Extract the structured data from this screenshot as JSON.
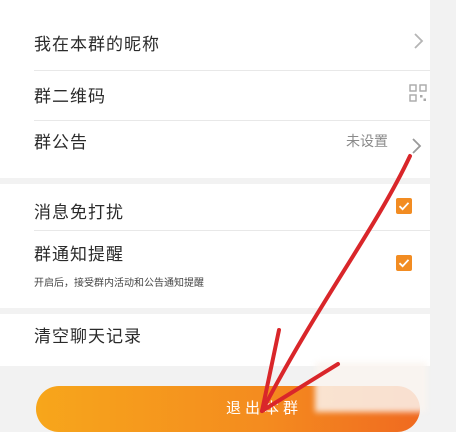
{
  "settings": {
    "nickname_label": "我在本群的昵称",
    "qrcode_label": "群二维码",
    "announcement_label": "群公告",
    "announcement_value": "未设置",
    "mute_label": "消息免打扰",
    "notify_label": "群通知提醒",
    "notify_desc": "开启后，接受群内活动和公告通知提醒",
    "clear_label": "清空聊天记录",
    "mute_checked": true,
    "notify_checked": true
  },
  "exit_button": {
    "label": "退出本群"
  },
  "colors": {
    "accent": "#f28c22",
    "annotation": "#d9262a"
  },
  "icons": {
    "chevron": "chevron-right-icon",
    "qrcode": "qrcode-icon",
    "check": "check-icon"
  }
}
